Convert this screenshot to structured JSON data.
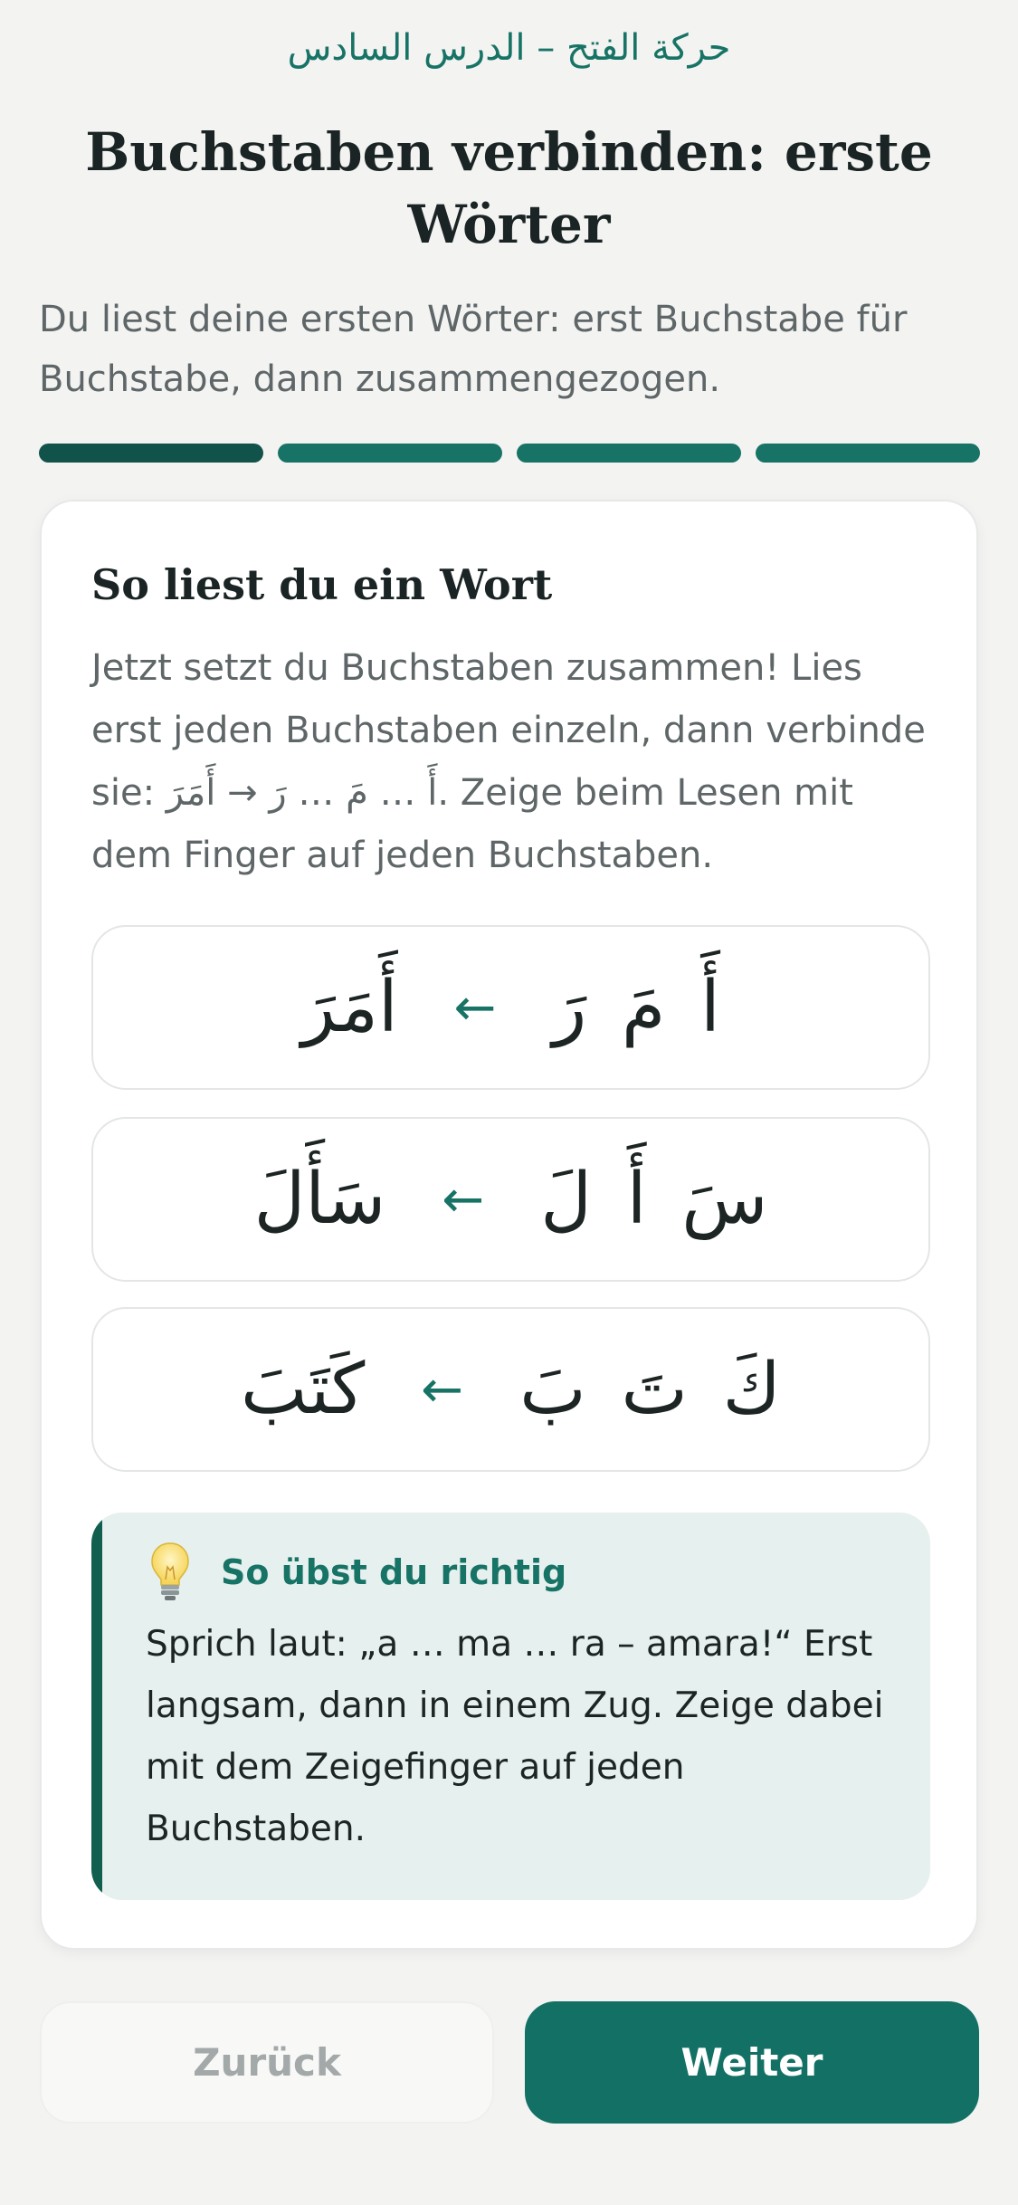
{
  "header": {
    "course_line": "حركة الفتح – الدرس السادس",
    "title": "Buchstaben verbinden: erste Wörter",
    "subtitle": "Du liest deine ersten Wörter: erst Buchstabe für Buchstabe, dann zusammengezogen."
  },
  "progress": {
    "segments": 4,
    "current": 1,
    "colors": {
      "active": "#11524a",
      "inactive": "#177365"
    }
  },
  "card": {
    "title": "So liest du ein Wort",
    "text": "Jetzt setzt du Buchstaben zusammen! Lies erst jeden Buchstaben einzeln, dann verbinde sie: أَ … مَ … رَ → أَمَرَ. Zeige beim Lesen mit dem Finger auf jeden Buchstaben.",
    "words": [
      {
        "letters": "أَ مَ رَ",
        "arrow": "←",
        "joined": "أَمَرَ"
      },
      {
        "letters": "سَ أَ لَ",
        "arrow": "←",
        "joined": "سَأَلَ"
      },
      {
        "letters": "كَ تَ بَ",
        "arrow": "←",
        "joined": "كَتَبَ"
      }
    ],
    "tip": {
      "icon": "lightbulb-icon",
      "title": "So übst du richtig",
      "text": "Sprich laut: „a … ma … ra – amara!“ Erst langsam, dann in einem Zug. Zeige dabei mit dem Zeigefinger auf jeden Buchstaben."
    }
  },
  "footer": {
    "back_label": "Zurück",
    "next_label": "Weiter"
  },
  "colors": {
    "accent": "#177365",
    "button_primary": "#137064",
    "tip_background": "#e6f0ee"
  }
}
